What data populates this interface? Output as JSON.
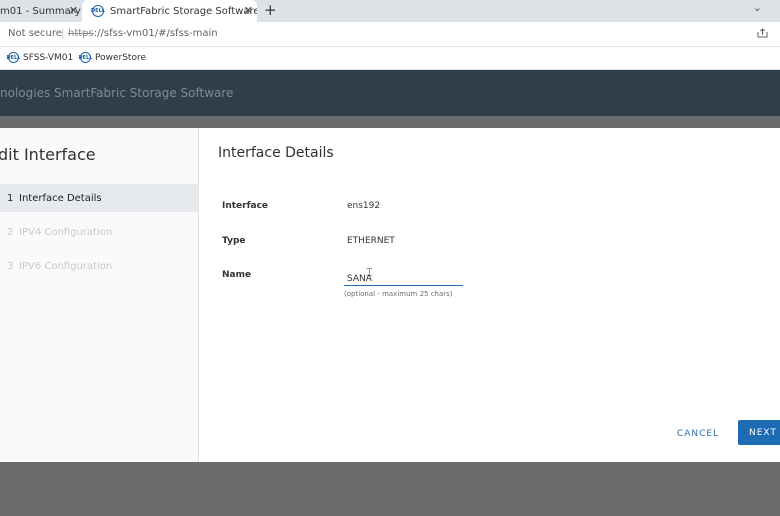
{
  "browser": {
    "tabs": [
      {
        "label": "m01 - Summary"
      },
      {
        "label": "SmartFabric Storage Software"
      }
    ],
    "favicon_text": "DELL",
    "security_label": "Not secure",
    "url_scheme": "https",
    "url_rest": "://sfss-vm01/#/sfss-main",
    "bookmarks": [
      {
        "label": "SFSS-VM01"
      },
      {
        "label": "PowerStore"
      }
    ]
  },
  "app": {
    "title": "nologies  SmartFabric Storage Software"
  },
  "wizard": {
    "title": "dit Interface",
    "steps": [
      {
        "num": "1",
        "label": "Interface Details",
        "state": "active"
      },
      {
        "num": "2",
        "label": "IPV4 Configuration",
        "state": "disabled"
      },
      {
        "num": "3",
        "label": "IPV6 Configuration",
        "state": "disabled"
      }
    ],
    "section_title": "Interface Details",
    "fields": {
      "interface": {
        "label": "Interface",
        "value": "ens192"
      },
      "type": {
        "label": "Type",
        "value": "ETHERNET"
      },
      "name": {
        "label": "Name",
        "value": "SANA",
        "helper": "(optional - maximum 25 chars)"
      }
    },
    "buttons": {
      "cancel": "CANCEL",
      "next": "NEXT"
    }
  },
  "colors": {
    "accent": "#1c6bb3",
    "header_bg": "#2f3e4b",
    "overlay": "#6b6b6b"
  }
}
